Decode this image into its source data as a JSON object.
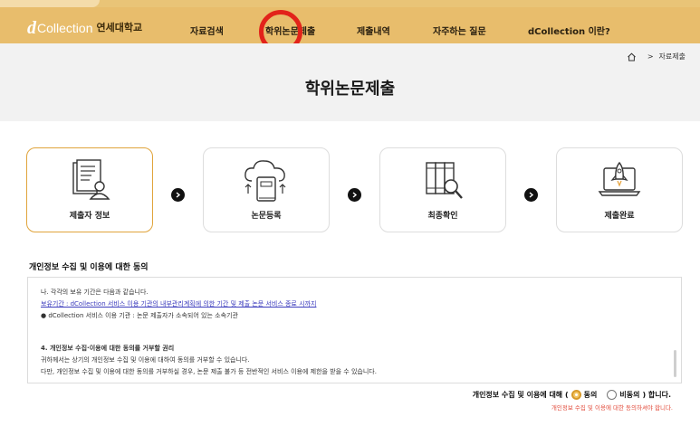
{
  "header": {
    "logo_prefix": "d",
    "logo_word": "Collection",
    "logo_univ": "연세대학교",
    "accent": "#e8bd6c"
  },
  "nav": {
    "items": [
      {
        "label": "자료검색"
      },
      {
        "label": "학위논문제출"
      },
      {
        "label": "제출내역"
      },
      {
        "label": "자주하는 질문"
      },
      {
        "label": "dCollection 이란?"
      }
    ]
  },
  "breadcrumb": {
    "home_icon": "home-icon",
    "current": "자료제출"
  },
  "page": {
    "title": "학위논문제출"
  },
  "steps": [
    {
      "label": "제출자 정보",
      "icon": "document-person-icon",
      "active": true
    },
    {
      "label": "논문등록",
      "icon": "cloud-book-icon",
      "active": false
    },
    {
      "label": "최종확인",
      "icon": "binders-search-icon",
      "active": false
    },
    {
      "label": "제출완료",
      "icon": "laptop-rocket-icon",
      "active": false
    }
  ],
  "consent": {
    "section_title": "개인정보 수집 및 이용에 대한 동의",
    "lines": [
      "나. 각각의 보유 기간은 다음과 같습니다.",
      "보유기간 : dCollection 서비스 이용 기관의 내부관리계획에 의한 기간 및 제출 논문 서비스 종료 시까지",
      "● dCollection 서비스 이용 기관 : 논문 제출자가 소속되어 있는 소속기관",
      "4. 개인정보 수집·이용에 대한 동의를 거부할 권리",
      "귀하께서는 상기의 개인정보 수집 및 이용에 대하여 동의를 거부할 수 있습니다.",
      "다만, 개인정보 수집 및 이용에 대한 동의를 거부하실 경우, 논문 제출 불가 등 전반적인 서비스 이용에 제한을 받을 수 있습니다."
    ],
    "agree_prefix": "개인정보 수집 및 이용에 대해 (",
    "agree_option": "동의",
    "disagree_option": "비동의",
    "agree_suffix": ") 합니다.",
    "warning": "개인정보 수집 및 이용에 대한 동의하셔야 합니다.",
    "agree_selected": true
  }
}
